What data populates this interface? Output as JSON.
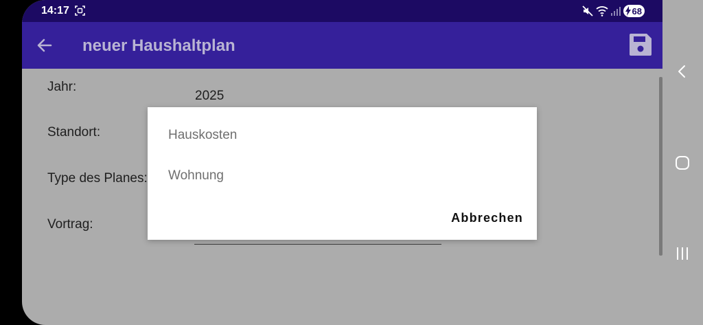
{
  "status_bar": {
    "time": "14:17",
    "battery_level": "68",
    "icons": [
      "screenshot-icon",
      "mute-icon",
      "wifi-icon",
      "signal-icon",
      "charging-icon"
    ]
  },
  "app_bar": {
    "title": "neuer Haushaltplan",
    "back_icon": "arrow-left-icon",
    "save_icon": "save-icon"
  },
  "form": {
    "year_label": "Jahr:",
    "year_value": "2025",
    "location_label": "Standort:",
    "plan_type_label": "Type des Planes:",
    "carryover_label": "Vortrag:"
  },
  "dialog": {
    "options": [
      "Hauskosten",
      "Wohnung"
    ],
    "cancel_label": "Abbrechen"
  },
  "nav_bar": {
    "icons": [
      "back-chevron-icon",
      "home-icon",
      "recents-icon"
    ]
  },
  "colors": {
    "status_bar": "#1c0a63",
    "app_bar": "#35209a",
    "scrim_background": "#acacac",
    "dialog_background": "#ffffff"
  }
}
